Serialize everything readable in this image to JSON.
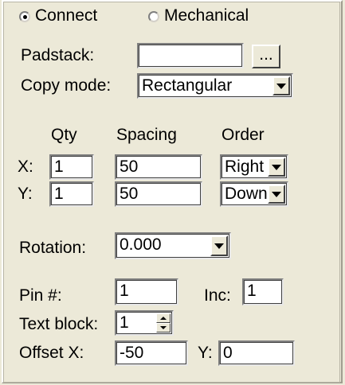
{
  "mode": {
    "connect_label": "Connect",
    "mechanical_label": "Mechanical",
    "selected": "Connect"
  },
  "padstack": {
    "label": "Padstack:",
    "value": "",
    "browse_label": "..."
  },
  "copy_mode": {
    "label": "Copy mode:",
    "value": "Rectangular"
  },
  "grid": {
    "qty_header": "Qty",
    "spacing_header": "Spacing",
    "order_header": "Order",
    "x_label": "X:",
    "y_label": "Y:",
    "x": {
      "qty": "1",
      "spacing": "50",
      "order": "Right"
    },
    "y": {
      "qty": "1",
      "spacing": "50",
      "order": "Down"
    }
  },
  "rotation": {
    "label": "Rotation:",
    "value": "0.000"
  },
  "pin": {
    "label": "Pin #:",
    "value": "1",
    "inc_label": "Inc:",
    "inc_value": "1"
  },
  "text_block": {
    "label": "Text block:",
    "value": "1"
  },
  "offset": {
    "x_label": "Offset X:",
    "x_value": "-50",
    "y_label": "Y:",
    "y_value": "0"
  },
  "colors": {
    "panel_bg": "#ece9d8",
    "field_bg": "#ffffff"
  }
}
